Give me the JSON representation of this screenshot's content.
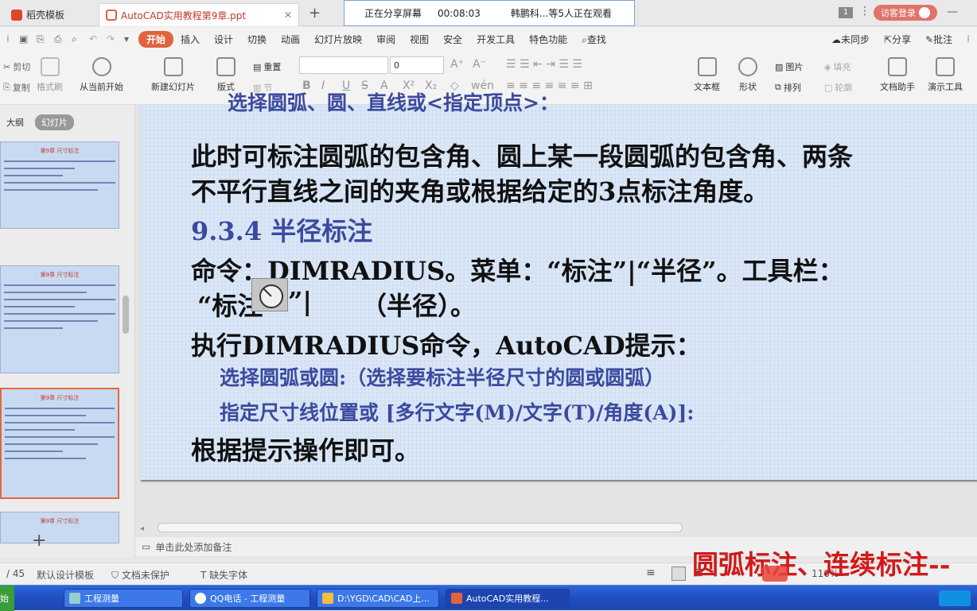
{
  "tabs": [
    {
      "label": "稻壳模板"
    },
    {
      "label": "AutoCAD实用教程第9章.ppt"
    }
  ],
  "share": {
    "status": "正在分享屏幕",
    "timer": "00:08:03",
    "viewers": "韩鹏科...等5人正在观看"
  },
  "window_badge": "1",
  "login": "访客登录",
  "menu": [
    "开始",
    "插入",
    "设计",
    "切换",
    "动画",
    "幻灯片放映",
    "审阅",
    "视图",
    "安全",
    "开发工具",
    "特色功能",
    "查找"
  ],
  "menu_right": [
    "未同步",
    "分享",
    "批注"
  ],
  "ribbon": {
    "cut": "剪切",
    "copy": "复制",
    "painter": "格式刷",
    "play_from": "从当前开始",
    "new_slide": "新建幻灯片",
    "layout": "版式",
    "reset": "重置",
    "section": "节",
    "font_size": "0",
    "textbox": "文本框",
    "shape": "形状",
    "picture": "图片",
    "arrange": "排列",
    "fill": "填充",
    "outline": "轮廓",
    "doc_helper": "文档助手",
    "presenter": "演示工具"
  },
  "panel": {
    "outline": "大纲",
    "slides": "幻灯片",
    "thumb_title": "第9章 尺寸标注"
  },
  "slide": {
    "top_cut": "选择圆弧、圆、直线或<指定顶点>：",
    "p1_l1": "此时可标注圆弧的包含角、圆上某一段圆弧的包含角、两条",
    "p1_l2": "不平行直线之间的夹角或根据给定的3点标注角度。",
    "section": "9.3.4  半径标注",
    "p2_l1": "命令：DIMRADIUS。菜单：“标注”|“半径”。工具栏：",
    "p2_l2a": "“标注",
    "p2_l2b": "”|",
    "p2_l2c": "（半径）。",
    "p3": "执行DIMRADIUS命令，AutoCAD提示：",
    "prompt1": "选择圆弧或圆:（选择要标注半径尺寸的圆或圆弧）",
    "prompt2": "指定尺寸线位置或 [多行文字(M)/文字(T)/角度(A)]:",
    "p4": "根据提示操作即可。"
  },
  "notes": "单击此处添加备注",
  "status": {
    "page": "/ 45",
    "design": "默认设计模板",
    "protect": "文档未保护",
    "font": "缺失字体",
    "zoom": "110%"
  },
  "overlay_text": "圆弧标注、连续标注--",
  "taskbar": [
    {
      "label": "工程测量"
    },
    {
      "label": "QQ电话 - 工程测量"
    },
    {
      "label": "D:\\YGD\\CAD\\CAD上..."
    },
    {
      "label": "AutoCAD实用教程..."
    }
  ],
  "colors": {
    "accent": "#e0633d",
    "slide_bg": "#d9e6f6",
    "slide_blue": "#3b4a9e",
    "overlay_red": "#d11919",
    "taskbar": "#1f4fc0"
  }
}
